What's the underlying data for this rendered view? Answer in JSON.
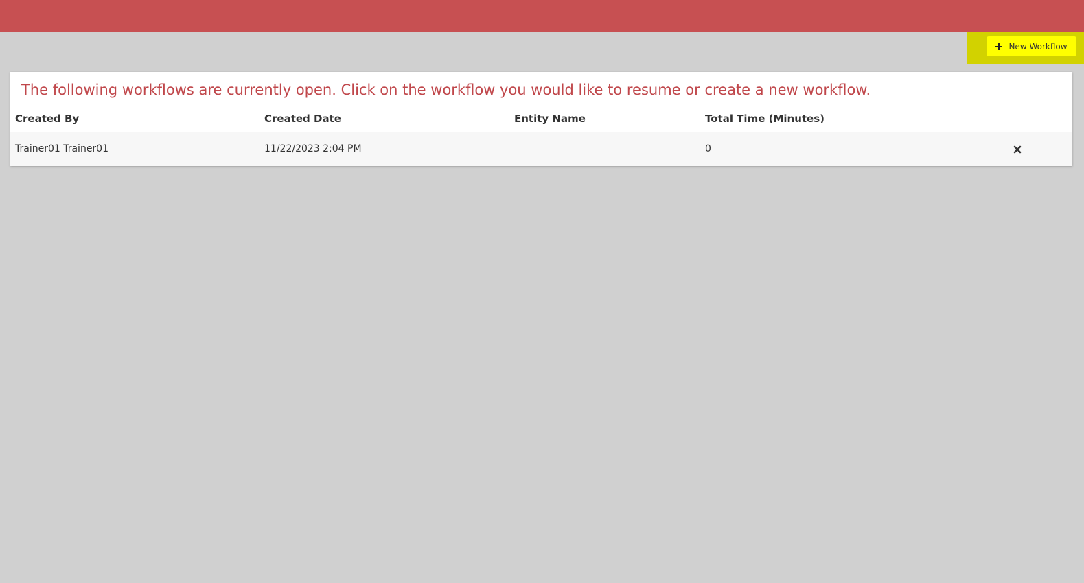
{
  "header": {
    "brand_color": "#c75052"
  },
  "toolbar": {
    "new_workflow_label": "New Workflow",
    "new_workflow_icon": "plus-icon",
    "highlight_color": "#d2d200",
    "button_color": "#ffff00"
  },
  "workflows": {
    "intro_text": "The following workflows are currently open. Click on the workflow you would like to resume or create a new workflow.",
    "columns": [
      "Created By",
      "Created Date",
      "Entity Name",
      "Total Time (Minutes)"
    ],
    "rows": [
      {
        "created_by": "Trainer01 Trainer01",
        "created_date": "11/22/2023 2:04 PM",
        "entity_name": "",
        "total_time": "0",
        "action_icon": "close-icon"
      }
    ]
  }
}
